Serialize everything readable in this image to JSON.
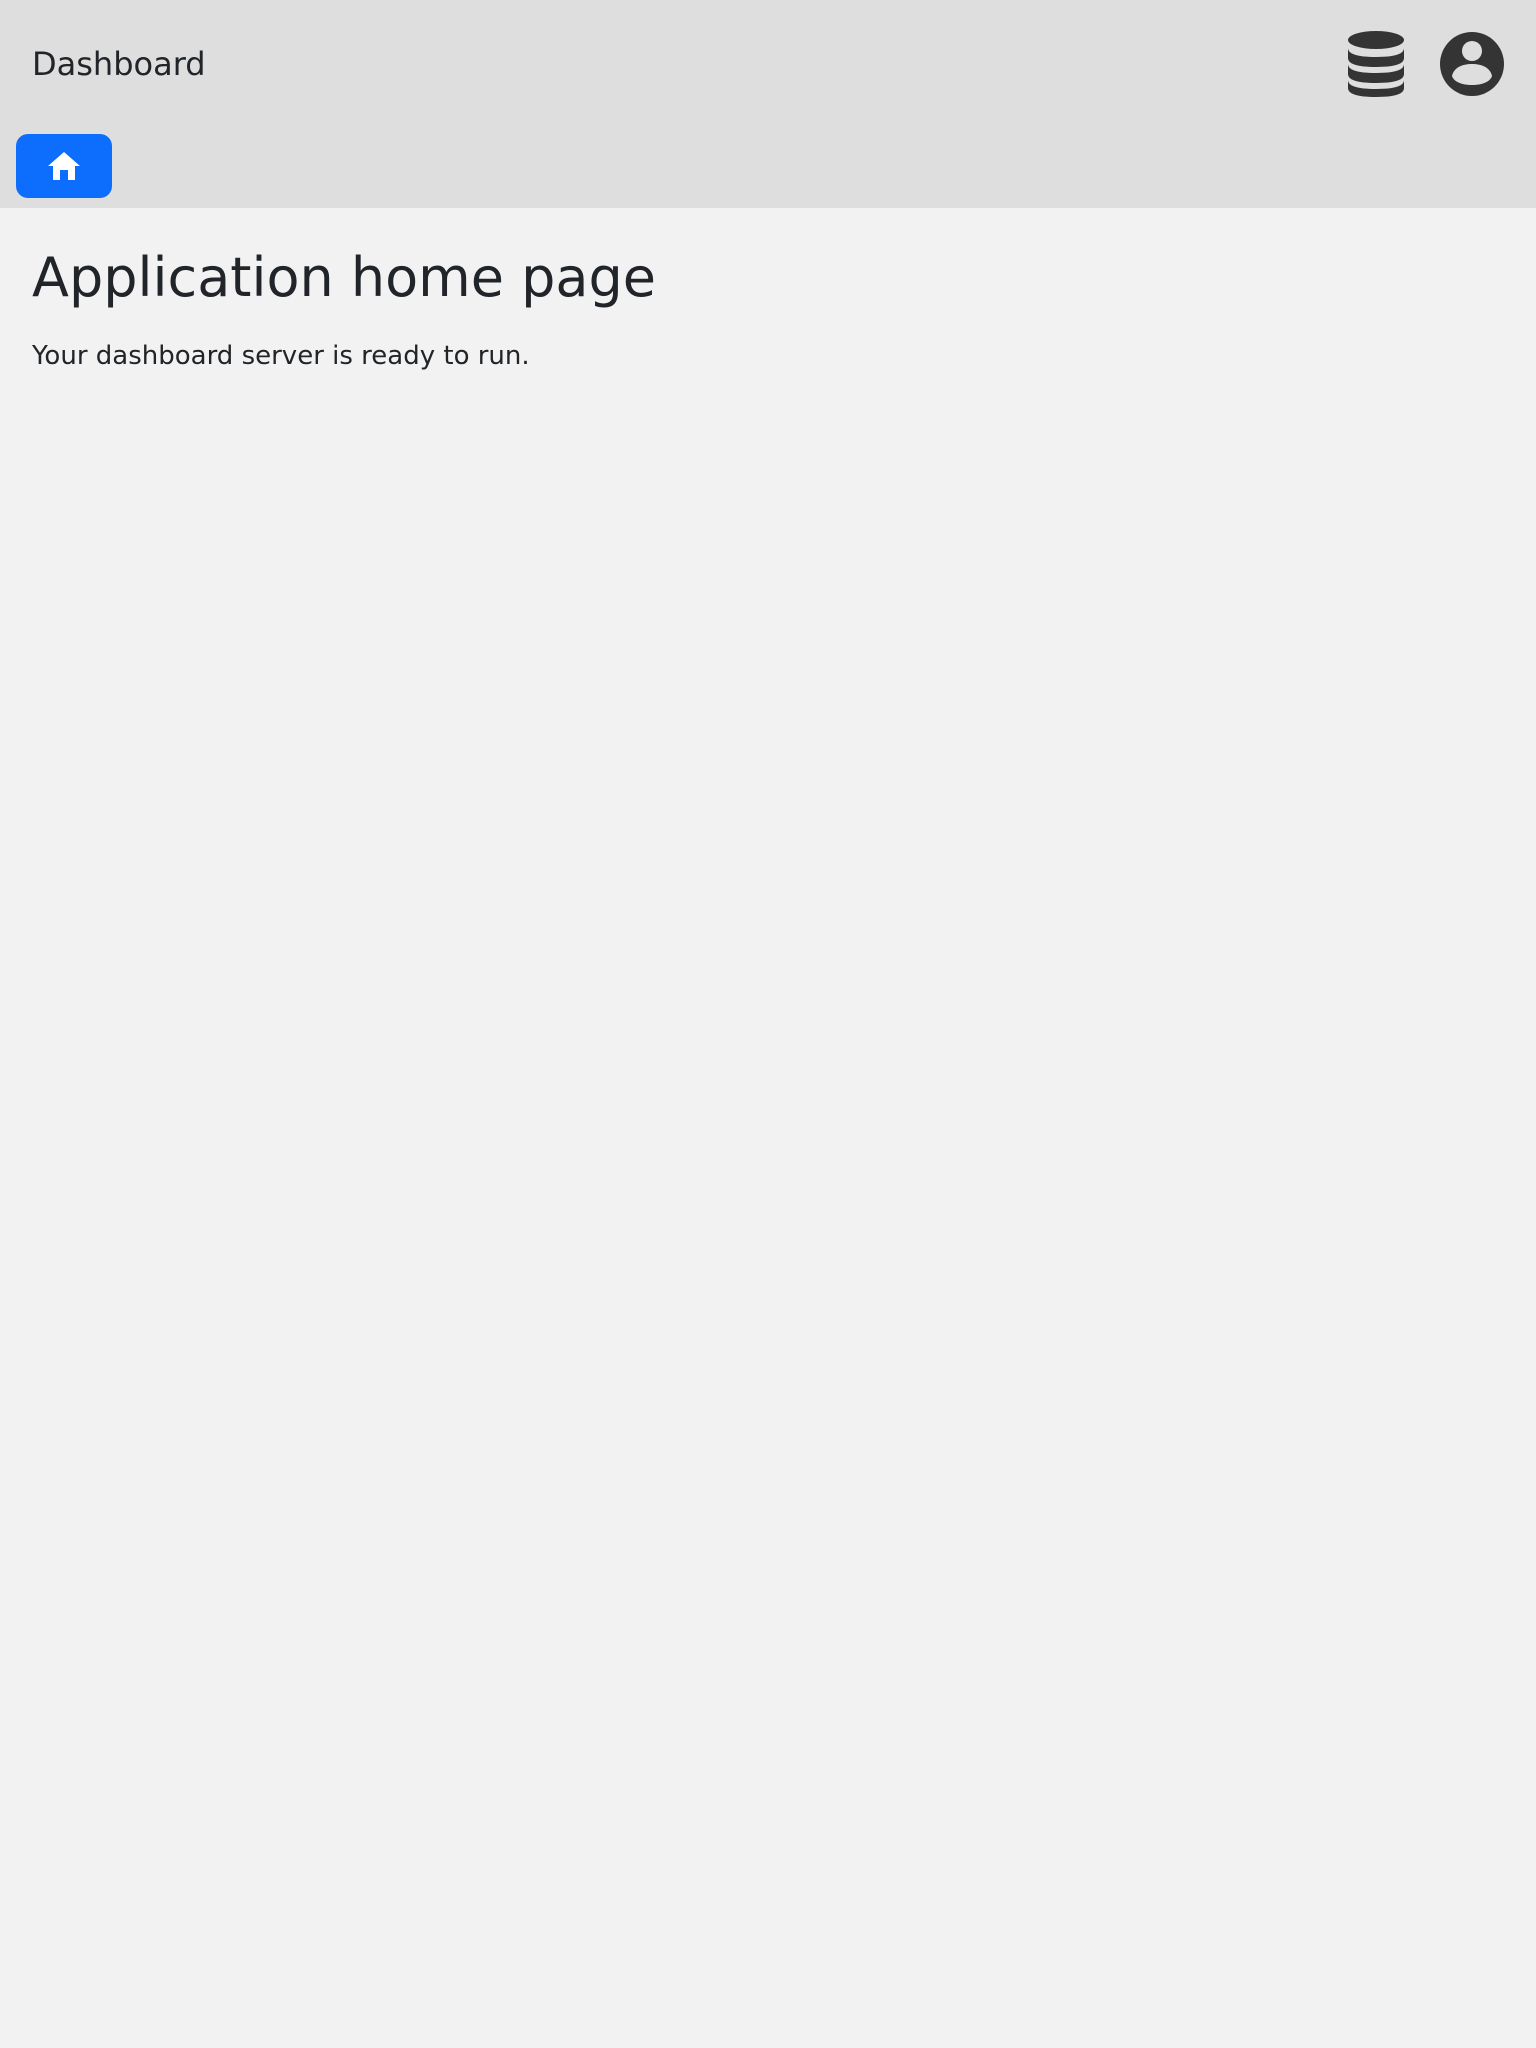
{
  "header": {
    "title": "Dashboard",
    "background_color": "#dedede",
    "icons": [
      "database-icon",
      "user-circle-icon"
    ]
  },
  "nav": {
    "home_button_icon": "home-icon",
    "home_button_color": "#0d6efd"
  },
  "main": {
    "heading": "Application home page",
    "body_text": "Your dashboard server is ready to run."
  }
}
